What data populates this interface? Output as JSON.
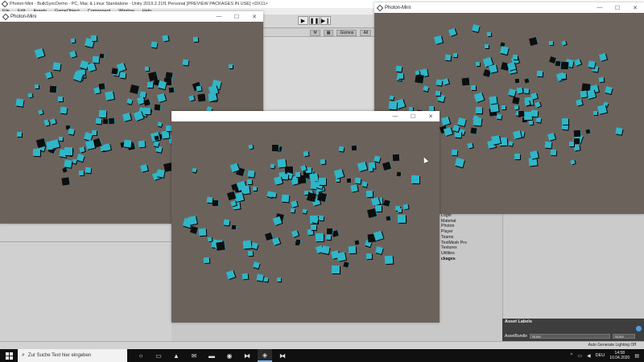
{
  "editor": {
    "title": "Photon-Mini - BulkSyncDemo - PC, Mac & Linux Standalone - Unity 2019.2.21f1 Personal [PREVIEW PACKAGES IN USE] <DX11>",
    "menu": [
      "File",
      "Edit",
      "Assets",
      "GameObject",
      "Component",
      "Window",
      "Help"
    ],
    "play_icons": [
      "play-icon",
      "pause-icon",
      "step-icon"
    ],
    "scene_bar": {
      "gizmos_label": "Gizmos",
      "search_label": "All"
    },
    "project_items": [
      "Login",
      "Material",
      "Photon",
      "Player",
      "Teams",
      "TextMesh Pro",
      "Textures",
      "Utilities",
      "ckages"
    ],
    "asset_labels": {
      "title": "Asset Labels",
      "bundle_label": "AssetBundle",
      "bundle_value": "None",
      "variant_value": "None"
    },
    "status": "Auto Generate Lighting Off"
  },
  "windows": {
    "left": {
      "title": "Photon-Mini"
    },
    "right": {
      "title": "Photon-Mini"
    },
    "mid": {
      "title": ""
    }
  },
  "taskbar": {
    "search_placeholder": "Zur Suche Text hier eingeben",
    "tray": {
      "language": "DEU",
      "time": "14:58",
      "date": "10.04.2020"
    }
  },
  "colors": {
    "game_background": "#6c625c",
    "cube_cyan": "#2fb6c8",
    "cube_dark": "#0e0e0e"
  }
}
